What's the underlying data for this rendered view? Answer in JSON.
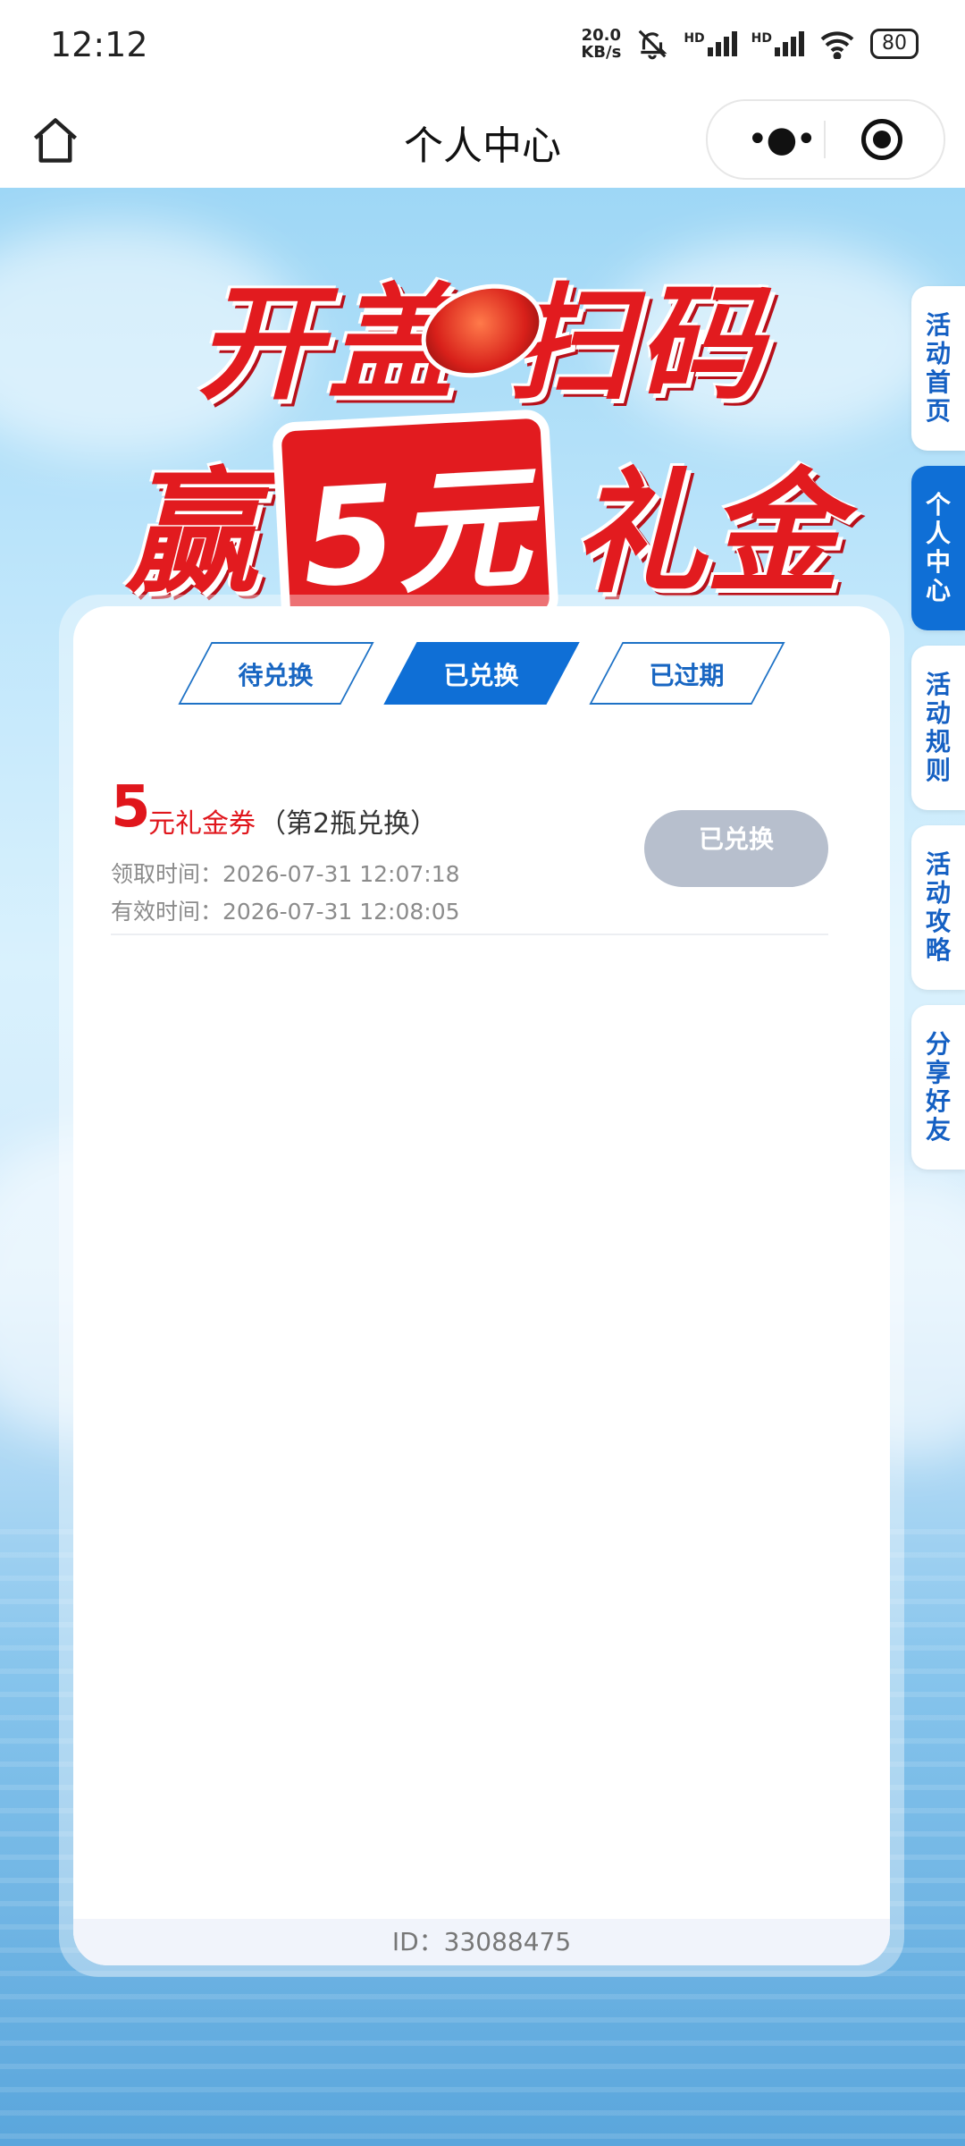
{
  "status_bar": {
    "time": "12:12",
    "net_speed_value": "20.0",
    "net_speed_unit": "KB/s",
    "signal_label": "HD",
    "battery": "80",
    "icons": [
      "mute-bell-icon",
      "signal-icon",
      "signal-icon",
      "wifi-icon",
      "battery-icon"
    ]
  },
  "nav": {
    "title": "个人中心",
    "more_label": "•●•"
  },
  "banner": {
    "line1": "开盖 扫码",
    "line2_prefix": "赢",
    "line2_highlight": "5元",
    "line2_suffix": "礼金"
  },
  "tabs": [
    {
      "label": "待兑换",
      "active": false
    },
    {
      "label": "已兑换",
      "active": true
    },
    {
      "label": "已过期",
      "active": false
    }
  ],
  "coupons": [
    {
      "amount": "5",
      "unit": "元礼金券",
      "note": "（第2瓶兑换）",
      "receive_time": "领取时间：2026-07-31 12:07:18",
      "valid_time": "有效时间：2026-07-31 12:08:05",
      "button_label": "已兑换"
    }
  ],
  "footer": {
    "id_text": "ID：33088475"
  },
  "side_nav": [
    {
      "label": "活动首页",
      "active": false
    },
    {
      "label": "个人中心",
      "active": true
    },
    {
      "label": "活动规则",
      "active": false
    },
    {
      "label": "活动攻略",
      "active": false
    },
    {
      "label": "分享好友",
      "active": false
    }
  ],
  "colors": {
    "accent_blue": "#0f6fd6",
    "brand_red": "#e21b1f",
    "disabled_button": "#b7bfcd"
  }
}
